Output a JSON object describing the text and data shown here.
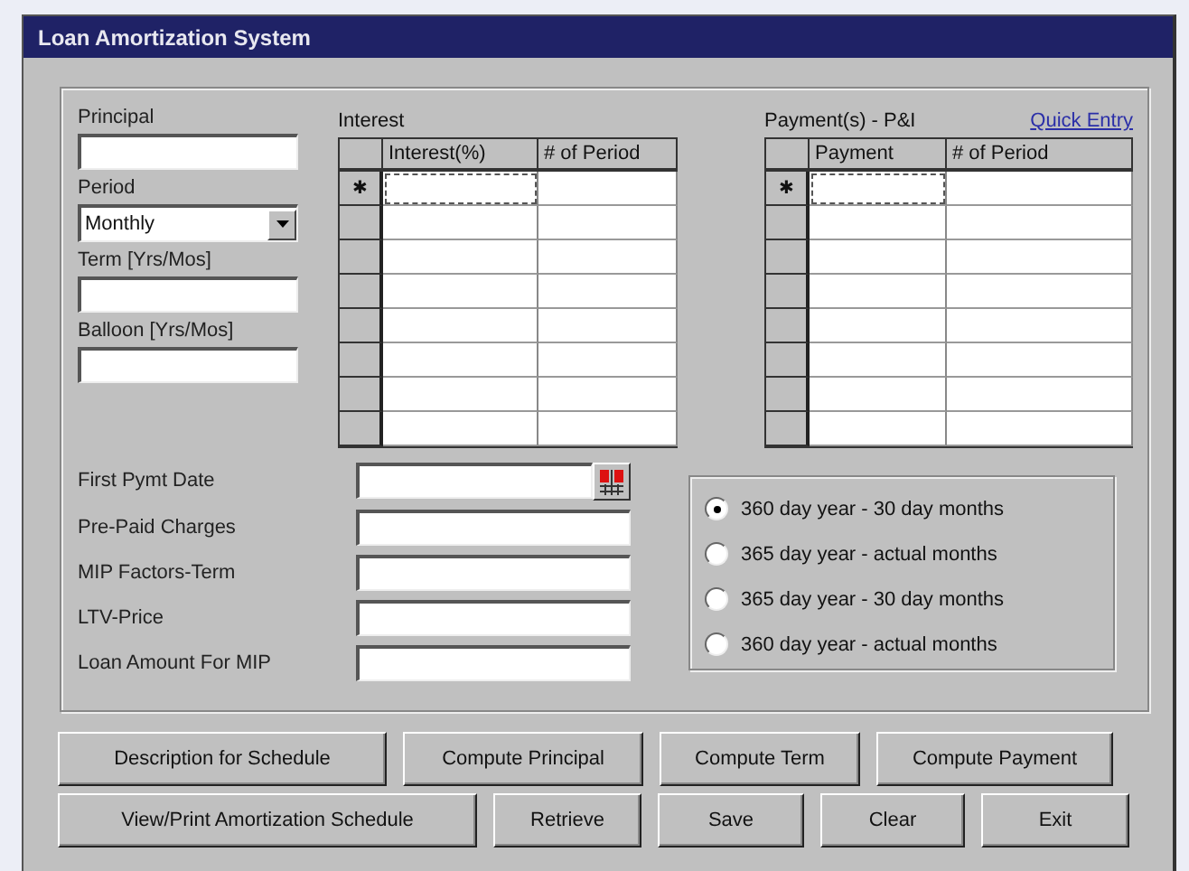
{
  "window": {
    "title": "Loan Amortization System"
  },
  "left_fields": [
    {
      "label": "Principal",
      "kind": "text"
    },
    {
      "label": "Period",
      "kind": "select",
      "value": "Monthly"
    },
    {
      "label": "Term [Yrs/Mos]",
      "kind": "text"
    },
    {
      "label": "Balloon [Yrs/Mos]",
      "kind": "text"
    }
  ],
  "interest_grid": {
    "label": "Interest",
    "columns": [
      "Interest(%)",
      "# of Period"
    ],
    "new_row_marker": "✱"
  },
  "payment_grid": {
    "label": "Payment(s) - P&I",
    "link": "Quick Entry",
    "columns": [
      "Payment",
      "# of Period"
    ],
    "new_row_marker": "✱"
  },
  "lower_fields": [
    {
      "label": "First Pymt Date",
      "kind": "date"
    },
    {
      "label": "Pre-Paid Charges",
      "kind": "text"
    },
    {
      "label": "MIP Factors-Term",
      "kind": "text"
    },
    {
      "label": "LTV-Price",
      "kind": "text"
    },
    {
      "label": "Loan Amount For MIP",
      "kind": "text"
    }
  ],
  "day_count_options": [
    {
      "label": "360 day year - 30 day months",
      "selected": true
    },
    {
      "label": "365 day year - actual months",
      "selected": false
    },
    {
      "label": "365 day year - 30 day months",
      "selected": false
    },
    {
      "label": "360 day year - actual months",
      "selected": false
    }
  ],
  "button_rows": [
    [
      {
        "label": "Description for Schedule"
      },
      {
        "label": "Compute Principal"
      },
      {
        "label": "Compute Term"
      },
      {
        "label": "Compute Payment"
      }
    ],
    [
      {
        "label": "View/Print Amortization Schedule"
      },
      {
        "label": "Retrieve"
      },
      {
        "label": "Save"
      },
      {
        "label": "Clear"
      },
      {
        "label": "Exit"
      }
    ]
  ]
}
